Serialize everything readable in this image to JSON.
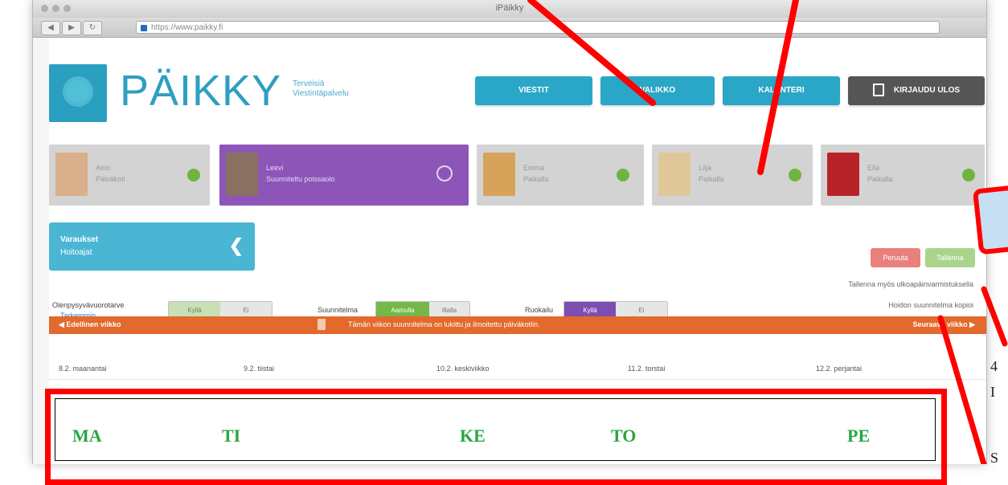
{
  "browser": {
    "window_title": "iPäikky",
    "url": "https://www.paikky.fi",
    "nav": {
      "back": "◀",
      "forward": "▶",
      "reload": "↻"
    }
  },
  "header": {
    "logo_text": "PÄIKKY",
    "tagline_line1": "Terveisiä",
    "tagline_line2": "Viestintäpalvelu",
    "buttons": [
      {
        "label": "VIESTIT",
        "style": "blue"
      },
      {
        "label": "VALIKKO",
        "style": "blue"
      },
      {
        "label": "KALENTERI",
        "style": "blue"
      },
      {
        "label": "KIRJAUDU ULOS",
        "style": "dark"
      }
    ]
  },
  "children": [
    {
      "name": "Aino",
      "subtitle": "Päiväkoti",
      "active": false,
      "status": "present",
      "photo_color": "#d9b08a"
    },
    {
      "name": "Leevi",
      "subtitle": "Suunniteltu poissaolo",
      "active": true,
      "status": "selected",
      "photo_color": "#8a7062"
    },
    {
      "name": "Emma",
      "subtitle": "Paikalla",
      "active": false,
      "status": "present",
      "photo_color": "#d7a25a"
    },
    {
      "name": "Lilja",
      "subtitle": "Paikalla",
      "active": false,
      "status": "present",
      "photo_color": "#e0c79a"
    },
    {
      "name": "Ella",
      "subtitle": "Paikalla",
      "active": false,
      "status": "present",
      "photo_color": "#b8232a"
    }
  ],
  "side_panel": {
    "line1": "Varaukset",
    "line2": "Hoitoajat",
    "chevron": "❮"
  },
  "actions": {
    "cancel_label": "Peruuta",
    "save_label": "Tallenna",
    "note_1": "Tallenna myös ulkoapäinvarmistuksella",
    "note_2": "Hoidon suunnitelma kopioi"
  },
  "filters": {
    "schedule_label": "Olenpysyvävuorotarve",
    "schedule_link": "Tarkemmin",
    "schedule_options": [
      "Kyllä",
      "Ei"
    ],
    "plan_label": "Suunnitelma",
    "plan_options": [
      "Aamulla",
      "Illalla"
    ],
    "meal_label": "Ruokailu",
    "meal_options": [
      "Kyllä",
      "Ei"
    ]
  },
  "week_bar": {
    "prev": "◀ Edellinen viikko",
    "notice": "Tämän viikon suunnitelma on lukittu ja ilmoitettu päiväkotiin.",
    "next": "Seuraava viikko ▶"
  },
  "days": [
    "8.2. maanantai",
    "9.2. tiistai",
    "10.2. keskiviikko",
    "11.2. torstai",
    "12.2. perjantai"
  ],
  "annotations": {
    "weekday_letters": [
      "MA",
      "TI",
      "KE",
      "TO",
      "PE"
    ],
    "edge_text": [
      "4",
      "I",
      "S"
    ],
    "colors": {
      "red": "#ff0000",
      "weekday_green": "#2aa640",
      "callout_fill": "#c7dff3"
    }
  }
}
